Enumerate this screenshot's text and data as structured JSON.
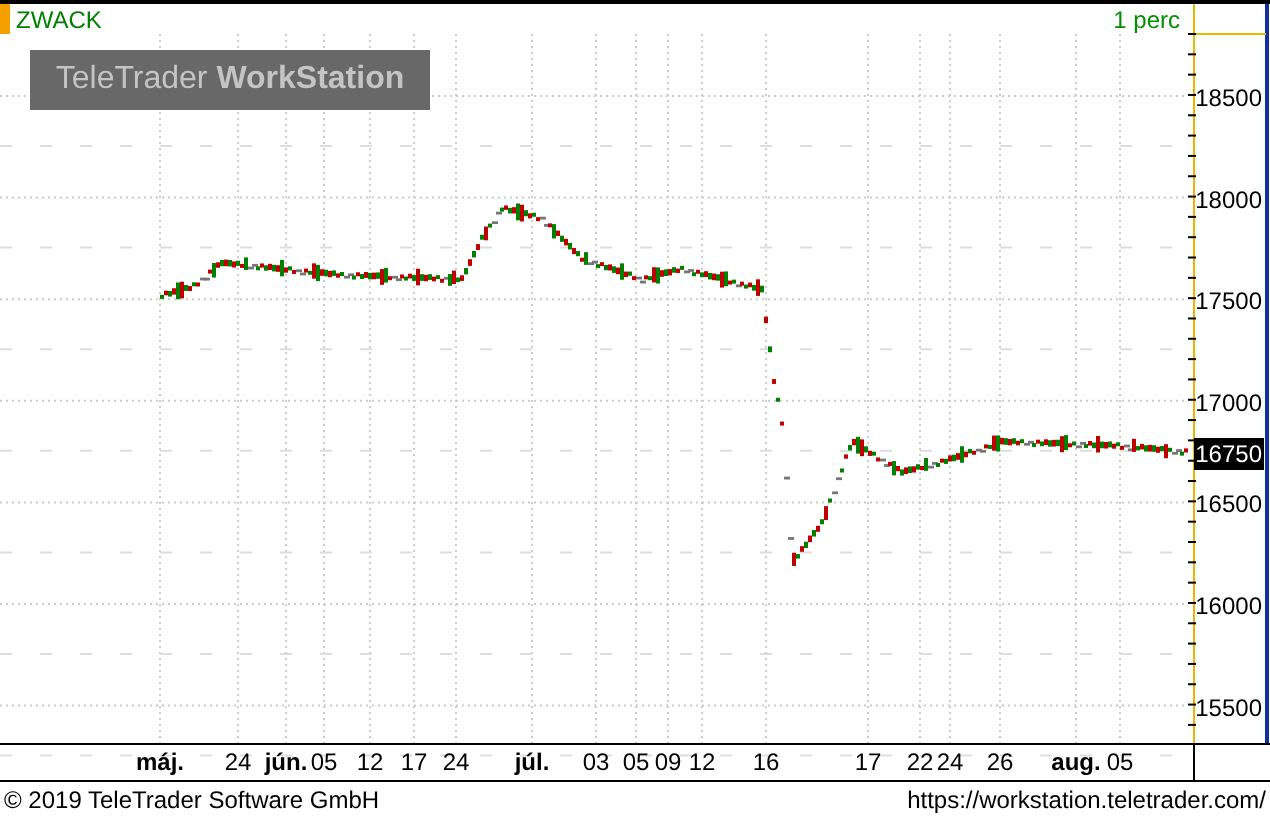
{
  "symbol": {
    "name": "ZWACK"
  },
  "interval": "1 perc",
  "logo": "TeleTrader **WorkStation**",
  "y_axis": {
    "ticks": [
      "18500",
      "18000",
      "17500",
      "17000",
      "16500",
      "16000",
      "15500"
    ]
  },
  "last_price": "16750",
  "x_axis": {
    "labels": [
      {
        "text": "máj.",
        "kind": "month"
      },
      {
        "text": "24",
        "kind": "day"
      },
      {
        "text": "jún.",
        "kind": "month"
      },
      {
        "text": "05",
        "kind": "day"
      },
      {
        "text": "12",
        "kind": "day"
      },
      {
        "text": "17",
        "kind": "day"
      },
      {
        "text": "24",
        "kind": "day"
      },
      {
        "text": "júl.",
        "kind": "month"
      },
      {
        "text": "03",
        "kind": "day"
      },
      {
        "text": "05",
        "kind": "day"
      },
      {
        "text": "09",
        "kind": "day"
      },
      {
        "text": "12",
        "kind": "day"
      },
      {
        "text": "16",
        "kind": "day"
      },
      {
        "text": "17",
        "kind": "day"
      },
      {
        "text": "22",
        "kind": "day"
      },
      {
        "text": "24",
        "kind": "day"
      },
      {
        "text": "26",
        "kind": "day"
      },
      {
        "text": "aug.",
        "kind": "month"
      },
      {
        "text": "05",
        "kind": "day"
      }
    ]
  },
  "footer": {
    "copyright": "© 2019 TeleTrader Software GmbH",
    "url": "https://workstation.teletrader.com/"
  }
}
